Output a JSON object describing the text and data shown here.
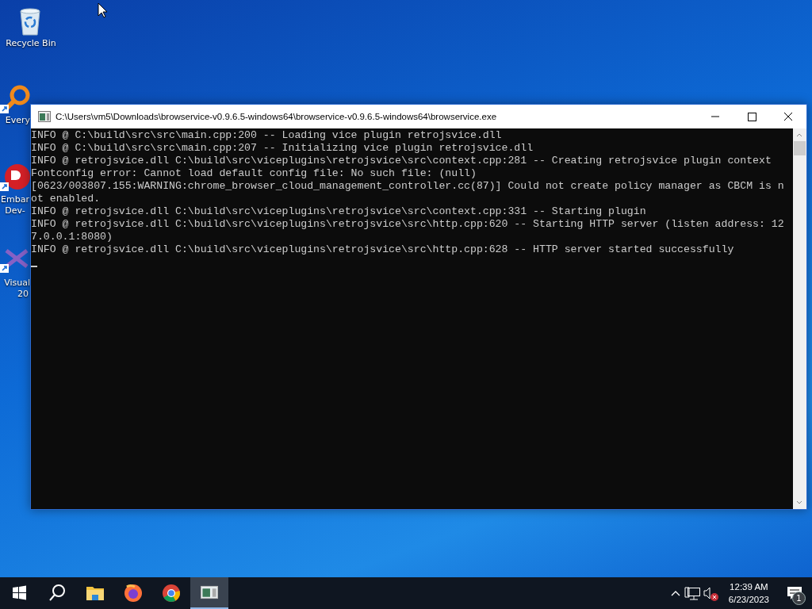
{
  "desktop_icons": [
    {
      "kind": "recycle",
      "lines": [
        "Recycle Bin"
      ]
    },
    {
      "kind": "search",
      "lines": [
        "Every"
      ]
    },
    {
      "kind": "delphi",
      "lines": [
        "Embar",
        "Dev-"
      ]
    },
    {
      "kind": "vs",
      "lines": [
        "Visual",
        "20"
      ]
    }
  ],
  "window": {
    "title": "C:\\Users\\vm5\\Downloads\\browservice-v0.9.6.5-windows64\\browservice-v0.9.6.5-windows64\\browservice.exe",
    "lines": [
      "INFO @ C:\\build\\src\\src\\main.cpp:200 -- Loading vice plugin retrojsvice.dll",
      "INFO @ C:\\build\\src\\src\\main.cpp:207 -- Initializing vice plugin retrojsvice.dll",
      "INFO @ retrojsvice.dll C:\\build\\src\\viceplugins\\retrojsvice\\src\\context.cpp:281 -- Creating retrojsvice plugin context",
      "Fontconfig error: Cannot load default config file: No such file: (null)",
      "[0623/003807.155:WARNING:chrome_browser_cloud_management_controller.cc(87)] Could not create policy manager as CBCM is n",
      "ot enabled.",
      "INFO @ retrojsvice.dll C:\\build\\src\\viceplugins\\retrojsvice\\src\\context.cpp:331 -- Starting plugin",
      "INFO @ retrojsvice.dll C:\\build\\src\\viceplugins\\retrojsvice\\src\\http.cpp:620 -- Starting HTTP server (listen address: 12",
      "7.0.0.1:8080)",
      "INFO @ retrojsvice.dll C:\\build\\src\\viceplugins\\retrojsvice\\src\\http.cpp:628 -- HTTP server started successfully"
    ]
  },
  "taskbar": {
    "apps": [
      {
        "kind": "explorer",
        "selected": false
      },
      {
        "kind": "firefox",
        "selected": false
      },
      {
        "kind": "chrome",
        "selected": false
      },
      {
        "kind": "console",
        "selected": true
      }
    ],
    "time": "12:39 AM",
    "date": "6/23/2023",
    "notification_count": "1"
  }
}
